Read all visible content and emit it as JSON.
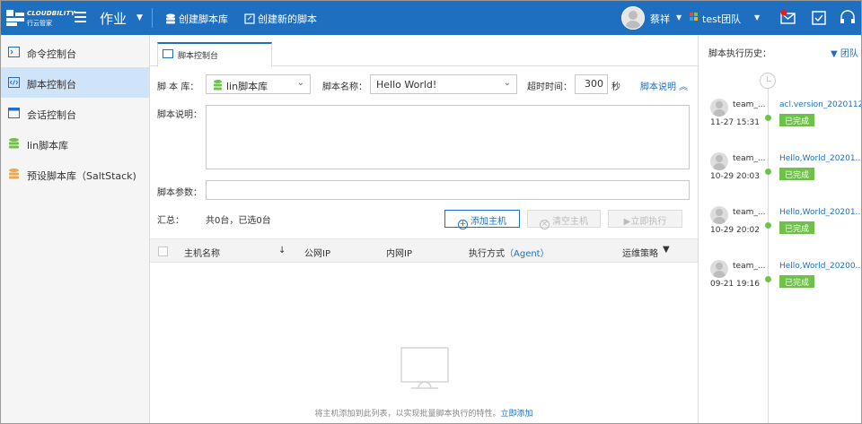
{
  "header": {
    "logo_text": "CLOUDBILITY",
    "logo_subtext": "行云管家",
    "module": "作业",
    "create_library": "创建脚本库",
    "create_script": "创建新的脚本",
    "user_name": "蔡祥",
    "team_name": "test团队",
    "colors": {
      "bar": "#1f6fc1",
      "notify_badge": "#e02020"
    }
  },
  "sidebar": {
    "items": [
      {
        "label": "命令控制台",
        "icon": "terminal-icon",
        "active": false
      },
      {
        "label": "脚本控制台",
        "icon": "code-icon",
        "active": true
      },
      {
        "label": "会话控制台",
        "icon": "window-icon",
        "active": false
      },
      {
        "label": "lin脚本库",
        "icon": "database-green-icon",
        "active": false
      },
      {
        "label": "预设脚本库（SaltStack)",
        "icon": "database-orange-icon",
        "active": false
      }
    ]
  },
  "main": {
    "tab_label": "脚本控制台",
    "library_label": "脚 本 库：",
    "library_value": "lin脚本库",
    "script_name_label": "脚本名称：",
    "script_name_value": "Hello World!",
    "timeout_label": "超时时间：",
    "timeout_value": "300",
    "timeout_unit": "秒",
    "script_desc_toggle": "脚本说明",
    "desc_label": "脚本说明：",
    "params_label": "脚本参数：",
    "summary_label": "汇总：",
    "summary_value": "共0台，已选0台",
    "add_host_button": "添加主机",
    "clear_host_button": "清空主机",
    "execute_button": "立即执行",
    "table_headers": {
      "host_name": "主机名称",
      "sort_arrow": "↓",
      "public_ip": "公网IP",
      "private_ip": "内网IP",
      "exec_mode": "执行方式",
      "exec_mode_agent": "（Agent）",
      "ops_policy": "运维策略"
    },
    "empty_text": "将主机添加到此列表，以实现批量脚本执行的特性。",
    "empty_link": "立即添加"
  },
  "history": {
    "title": "脚本执行历史：",
    "filter_label": "团队",
    "items": [
      {
        "user": "team_...",
        "time": "11-27 15:31",
        "script": "acl.version_2020112...",
        "status": "已完成"
      },
      {
        "user": "team_...",
        "time": "10-29 20:03",
        "script": "Hello,World_20201...",
        "status": "已完成"
      },
      {
        "user": "team_...",
        "time": "10-29 20:02",
        "script": "Hello,World_20201...",
        "status": "已完成"
      },
      {
        "user": "team_...",
        "time": "09-21 19:16",
        "script": "Hello,World_20200...",
        "status": "已完成"
      }
    ],
    "status_color": "#6fc14b"
  }
}
